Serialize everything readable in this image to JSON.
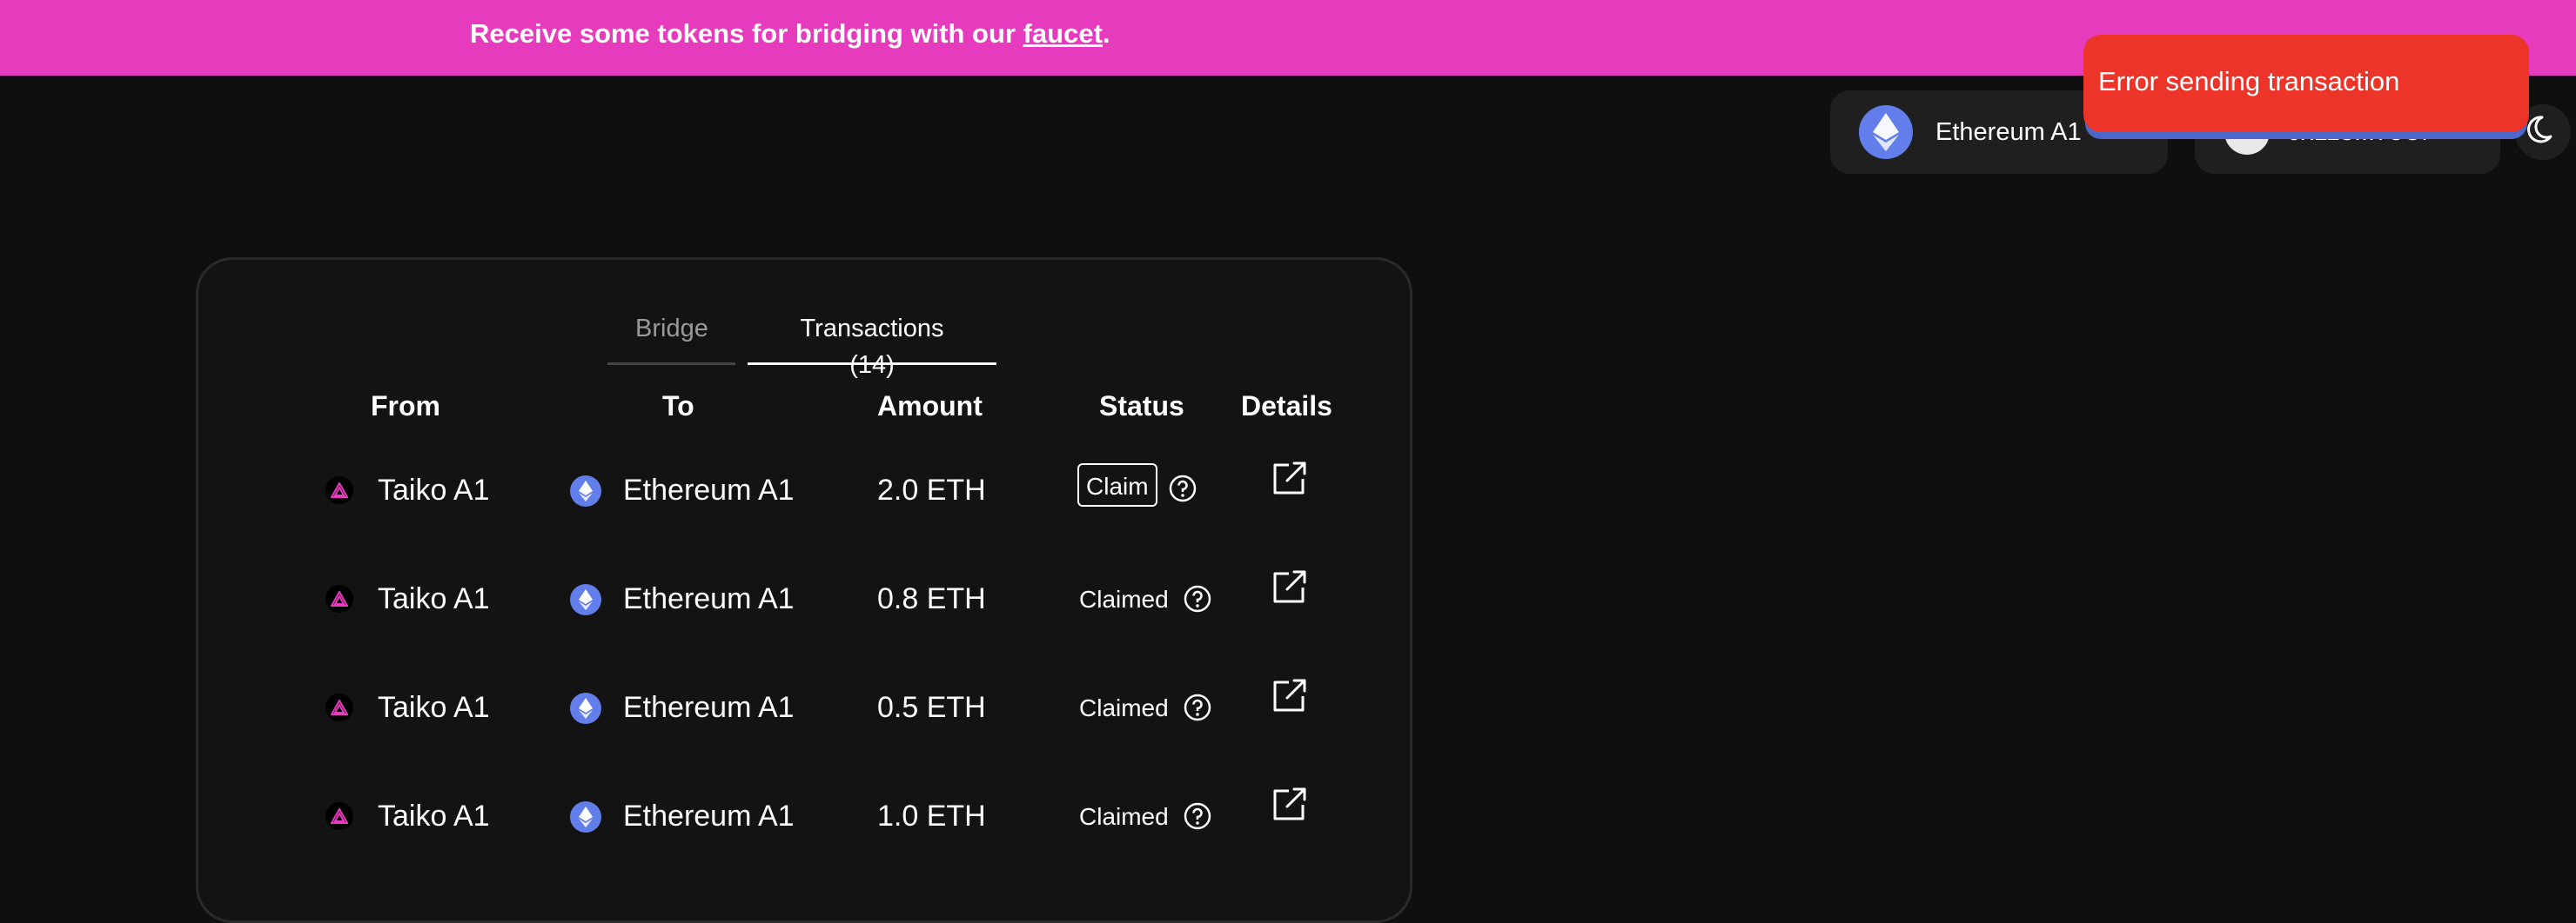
{
  "banner": {
    "text": "Receive some tokens for bridging with our ",
    "link": "faucet",
    "suffix": "."
  },
  "header": {
    "network": {
      "name": "Ethereum A1",
      "icon": "ethereum-icon"
    },
    "wallet": {
      "address": "0x113...78Cf"
    },
    "theme_icon": "moon-icon"
  },
  "toast": {
    "message": "Error sending transaction",
    "color": "#ec3428"
  },
  "tabs": [
    {
      "label": "Bridge",
      "active": false
    },
    {
      "label": "Transactions (14)",
      "active": true
    }
  ],
  "table": {
    "headers": [
      "From",
      "To",
      "Amount",
      "Status",
      "Details"
    ],
    "rows": [
      {
        "from": "Taiko A1",
        "to": "Ethereum A1",
        "amount": "2.0 ETH",
        "status": "Claim"
      },
      {
        "from": "Taiko A1",
        "to": "Ethereum A1",
        "amount": "0.8 ETH",
        "status": "Claimed"
      },
      {
        "from": "Taiko A1",
        "to": "Ethereum A1",
        "amount": "0.5 ETH",
        "status": "Claimed"
      },
      {
        "from": "Taiko A1",
        "to": "Ethereum A1",
        "amount": "1.0 ETH",
        "status": "Claimed"
      }
    ]
  },
  "colors": {
    "banner": "#e63bbc",
    "background": "#0f0f0f",
    "ethereum": "#627eea",
    "taiko": "#e63bbc"
  }
}
